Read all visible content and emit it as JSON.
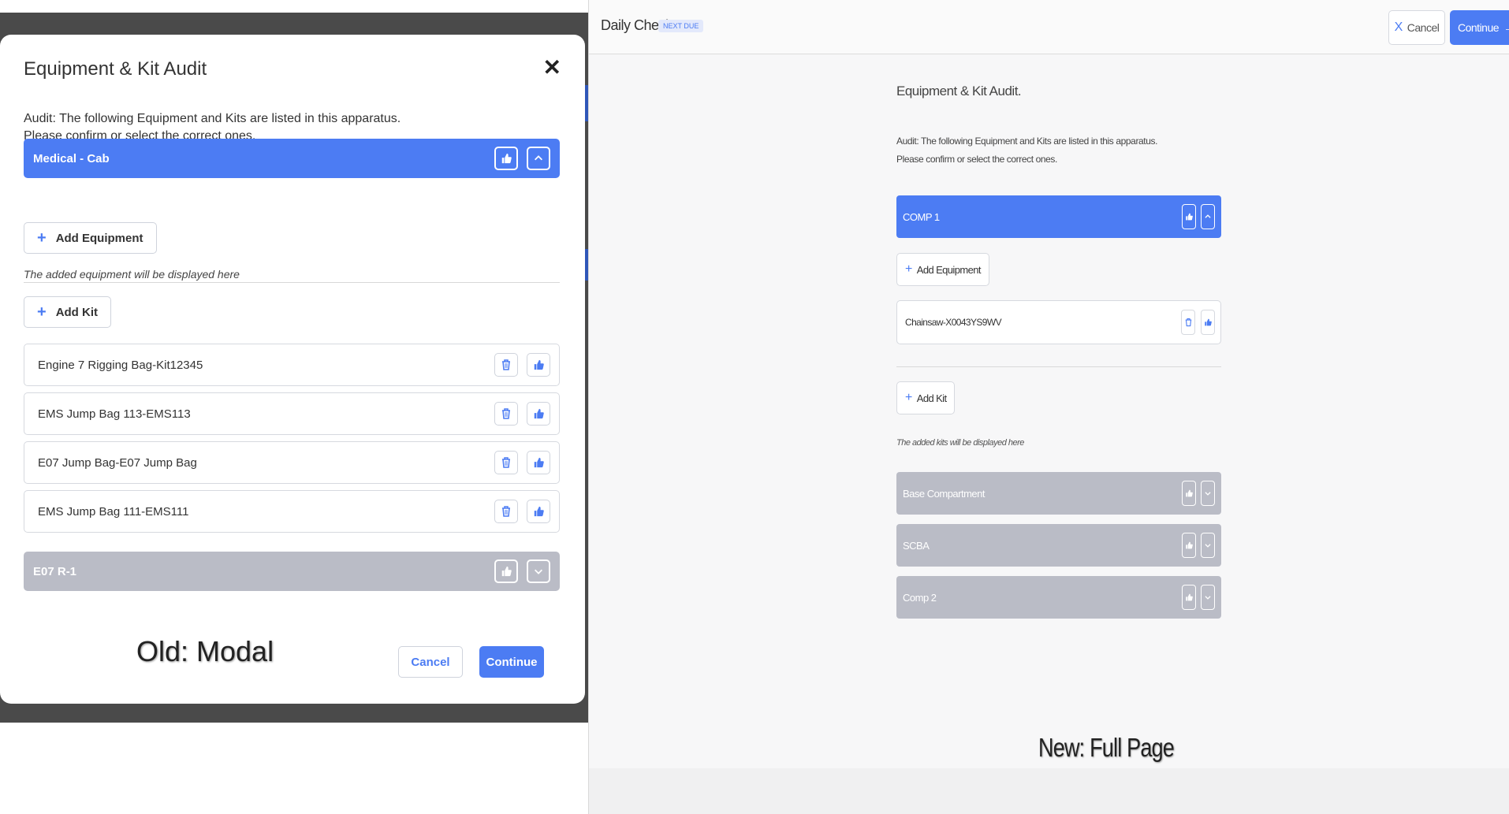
{
  "old_modal": {
    "title": "Equipment & Kit Audit",
    "close_glyph": "✕",
    "description_line1": "Audit: The following Equipment and Kits are listed in this apparatus.",
    "description_line2": "Please confirm or select the correct ones.",
    "compartment_expanded": {
      "label": "Medical - Cab",
      "thumb_icon": "thumbs-up-icon",
      "collapse_icon": "chevron-up-icon"
    },
    "add_equipment_label": "Add Equipment",
    "equipment_hint": "The added equipment will be displayed here",
    "add_kit_label": "Add Kit",
    "kits": [
      {
        "name": "Engine 7 Rigging Bag-Kit12345"
      },
      {
        "name": "EMS Jump Bag 113-EMS113"
      },
      {
        "name": "E07 Jump Bag-E07 Jump Bag"
      },
      {
        "name": "EMS Jump Bag 111-EMS111"
      }
    ],
    "compartment_collapsed": {
      "label": "E07 R-1",
      "thumb_icon": "thumbs-up-icon",
      "expand_icon": "chevron-down-icon"
    },
    "cancel_label": "Cancel",
    "continue_label": "Continue",
    "caption": "Old: Modal"
  },
  "new_page": {
    "page_title": "Daily Check",
    "badge": "NEXT DUE",
    "cancel_label": "Cancel",
    "continue_label": "Continue",
    "title": "Equipment & Kit Audit.",
    "description_line1": "Audit: The following Equipment and Kits are listed in this apparatus.",
    "description_line2": "Please confirm or select the correct ones.",
    "compartment_expanded": {
      "label": "COMP 1"
    },
    "add_equipment_label": "Add Equipment",
    "equipment_items": [
      {
        "name": "Chainsaw-X0043YS9WV"
      }
    ],
    "add_kit_label": "Add Kit",
    "kits_hint": "The added kits will be displayed here",
    "compartments_collapsed": [
      {
        "label": "Base Compartment"
      },
      {
        "label": "SCBA"
      },
      {
        "label": "Comp 2"
      }
    ],
    "caption": "New: Full Page"
  },
  "colors": {
    "accent": "#4c7cf3",
    "collapsed_bar": "#babcc6"
  }
}
